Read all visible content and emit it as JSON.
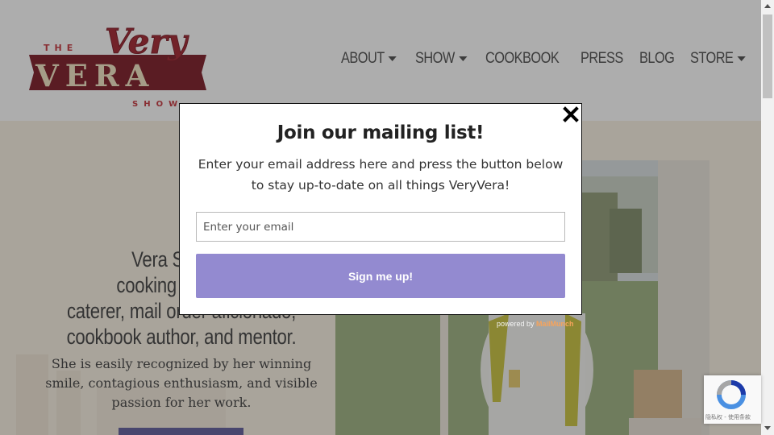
{
  "header": {
    "logo": {
      "top_text": "THE",
      "script_text": "Very",
      "main_text": "VERA",
      "bottom_text": "SHOW",
      "colors": {
        "maroon": "#7a1521",
        "red": "#c6323a",
        "cream": "#f3e6c4"
      }
    },
    "nav": [
      {
        "label": "ABOUT",
        "has_dropdown": true
      },
      {
        "label": "SHOW",
        "has_dropdown": true
      },
      {
        "label": "COOKBOOK",
        "has_dropdown": false
      },
      {
        "label": "PRESS",
        "has_dropdown": false
      },
      {
        "label": "BLOG",
        "has_dropdown": false
      },
      {
        "label": "STORE",
        "has_dropdown": true
      }
    ]
  },
  "hero": {
    "title_lines": [
      "Vera Stewart",
      "cooking show ho",
      "caterer, mail order aficionado,",
      "cookbook author, and mentor."
    ],
    "subtitle": "She is easily recognized by her winning smile, contagious enthusiasm, and visible passion for her work.",
    "accent": "#5c5a99"
  },
  "modal": {
    "title": "Join our mailing list!",
    "text": "Enter your email address here and press the button below to stay up-to-date on all things VeryVera!",
    "email_placeholder": "Enter your email",
    "email_value": "",
    "submit_label": "Sign me up!",
    "submit_color": "#938ad0",
    "powered_by": "powered by",
    "powered_brand": "MailMunch"
  },
  "recaptcha": {
    "label": "隐私权 - 使用条款"
  }
}
